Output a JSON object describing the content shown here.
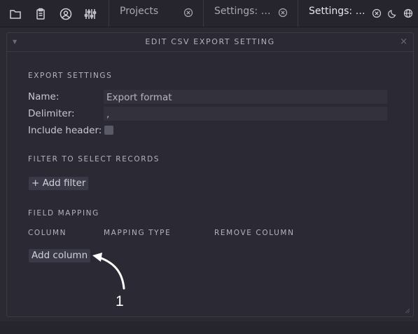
{
  "toolbar": {
    "icons": [
      "folder-icon",
      "clipboard-icon",
      "user-circle-icon",
      "sliders-icon"
    ],
    "tabs": [
      {
        "label": "Projects"
      },
      {
        "label": "Settings: …"
      },
      {
        "label": "Settings: …"
      }
    ],
    "right_icons": [
      "close-circle-icon",
      "moon-icon",
      "globe-icon"
    ]
  },
  "dialog": {
    "title": "EDIT CSV EXPORT SETTING",
    "collapse_glyph": "▼",
    "close_glyph": "×"
  },
  "export_settings": {
    "title": "EXPORT SETTINGS",
    "name_label": "Name:",
    "name_value": "Export format",
    "delimiter_label": "Delimiter:",
    "delimiter_value": ",",
    "include_header_label": "Include header:",
    "include_header_checked": false
  },
  "filter": {
    "title": "FILTER TO SELECT RECORDS",
    "add_filter_label": "+ Add filter"
  },
  "field_mapping": {
    "title": "FIELD MAPPING",
    "columns": [
      "COLUMN",
      "MAPPING TYPE",
      "REMOVE COLUMN"
    ],
    "add_column_label": "Add column"
  },
  "annotation": {
    "number": "1"
  },
  "colors": {
    "background": "#2b2a33",
    "field": "#33323c",
    "button": "#3a3948",
    "annotation": "#ffffff"
  }
}
